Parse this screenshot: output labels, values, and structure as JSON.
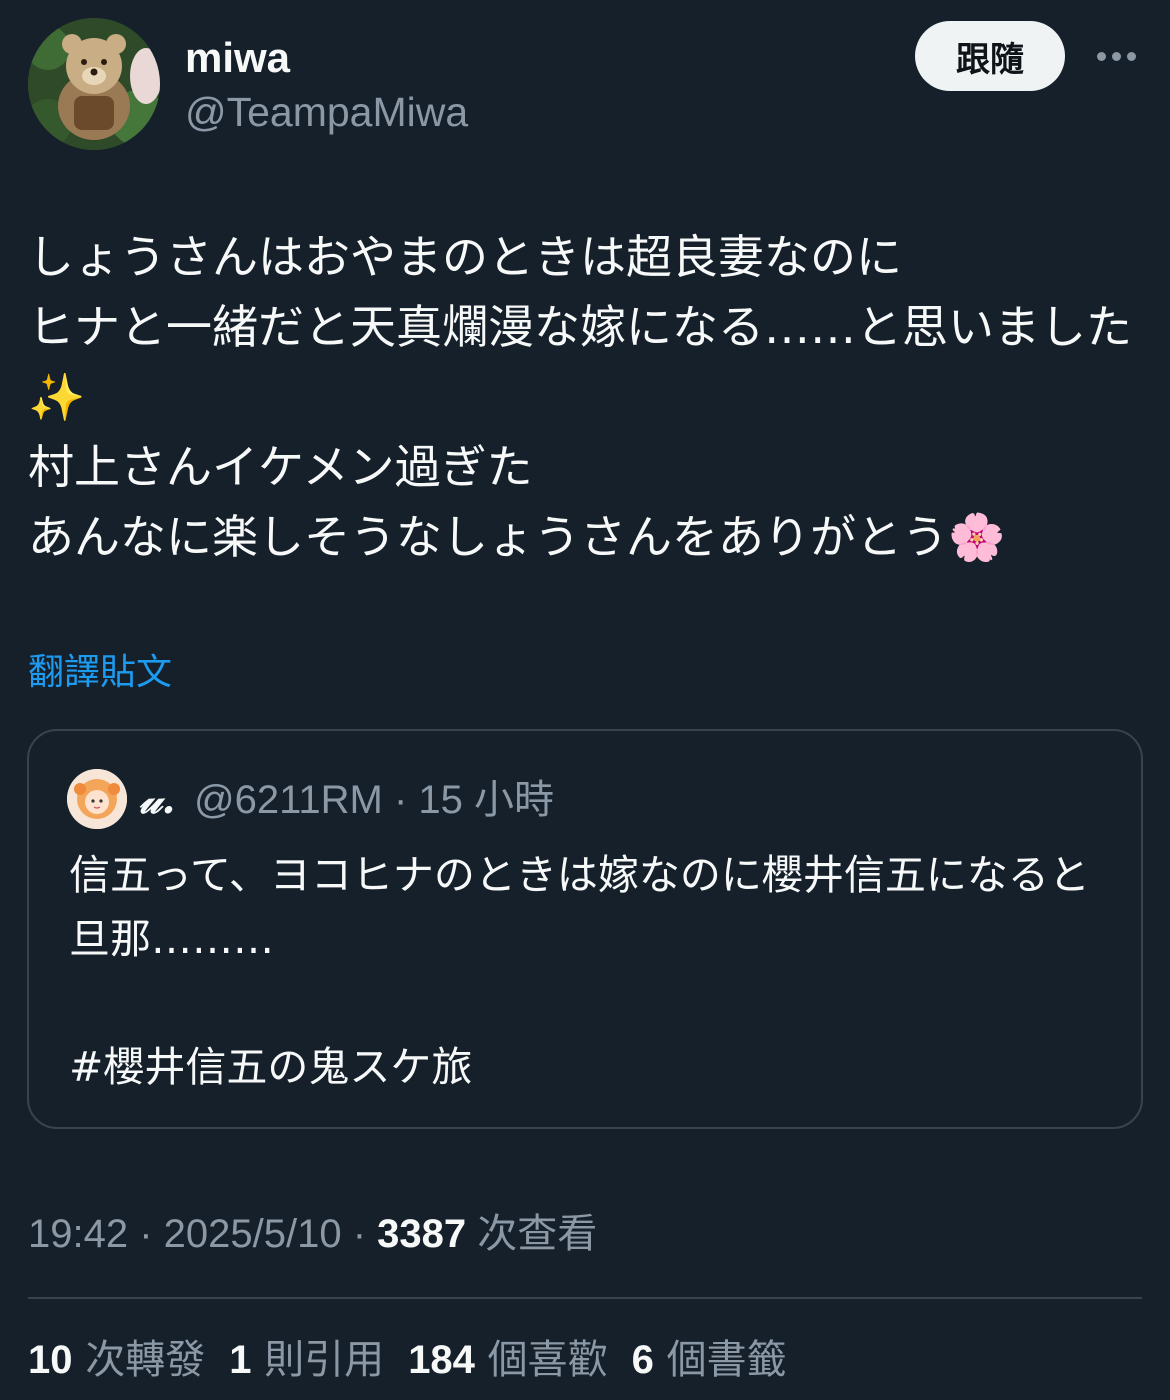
{
  "author": {
    "display_name": "miwa",
    "handle": "@TeampaMiwa",
    "avatar_icon": "teddy-bear-photo-avatar"
  },
  "follow_label": "跟隨",
  "more_icon": "more-horizontal-icon",
  "tweet_text": "しょうさんはおやまのときは超良妻なのに\nヒナと一緒だと天真爛漫な嫁になる……と思いました✨\n村上さんイケメン過ぎた\nあんなに楽しそうなしょうさんをありがとう🌸",
  "translate_label": "翻譯貼文",
  "quote": {
    "name": "𝓊.",
    "handle": "@6211RM",
    "separator": "·",
    "time": "15 小時",
    "text": "信五って、ヨコヒナのときは嫁なのに櫻井信五になると旦那………\n\n#櫻井信五の鬼スケ旅",
    "avatar_icon": "anime-girl-avatar"
  },
  "meta": {
    "time": "19:42",
    "date": "2025/5/10",
    "views": "3387",
    "views_label": "次查看"
  },
  "stats": {
    "retweets": "10",
    "retweets_label": "次轉發",
    "quotes": "1",
    "quotes_label": "則引用",
    "likes": "184",
    "likes_label": "個喜歡",
    "bookmarks": "6",
    "bookmarks_label": "個書籤"
  },
  "colors": {
    "background": "#15202b",
    "text": "#f7f9f9",
    "secondary": "#8b98a5",
    "link": "#1d9bf0",
    "border": "#38444d",
    "button_bg": "#eff3f4"
  }
}
